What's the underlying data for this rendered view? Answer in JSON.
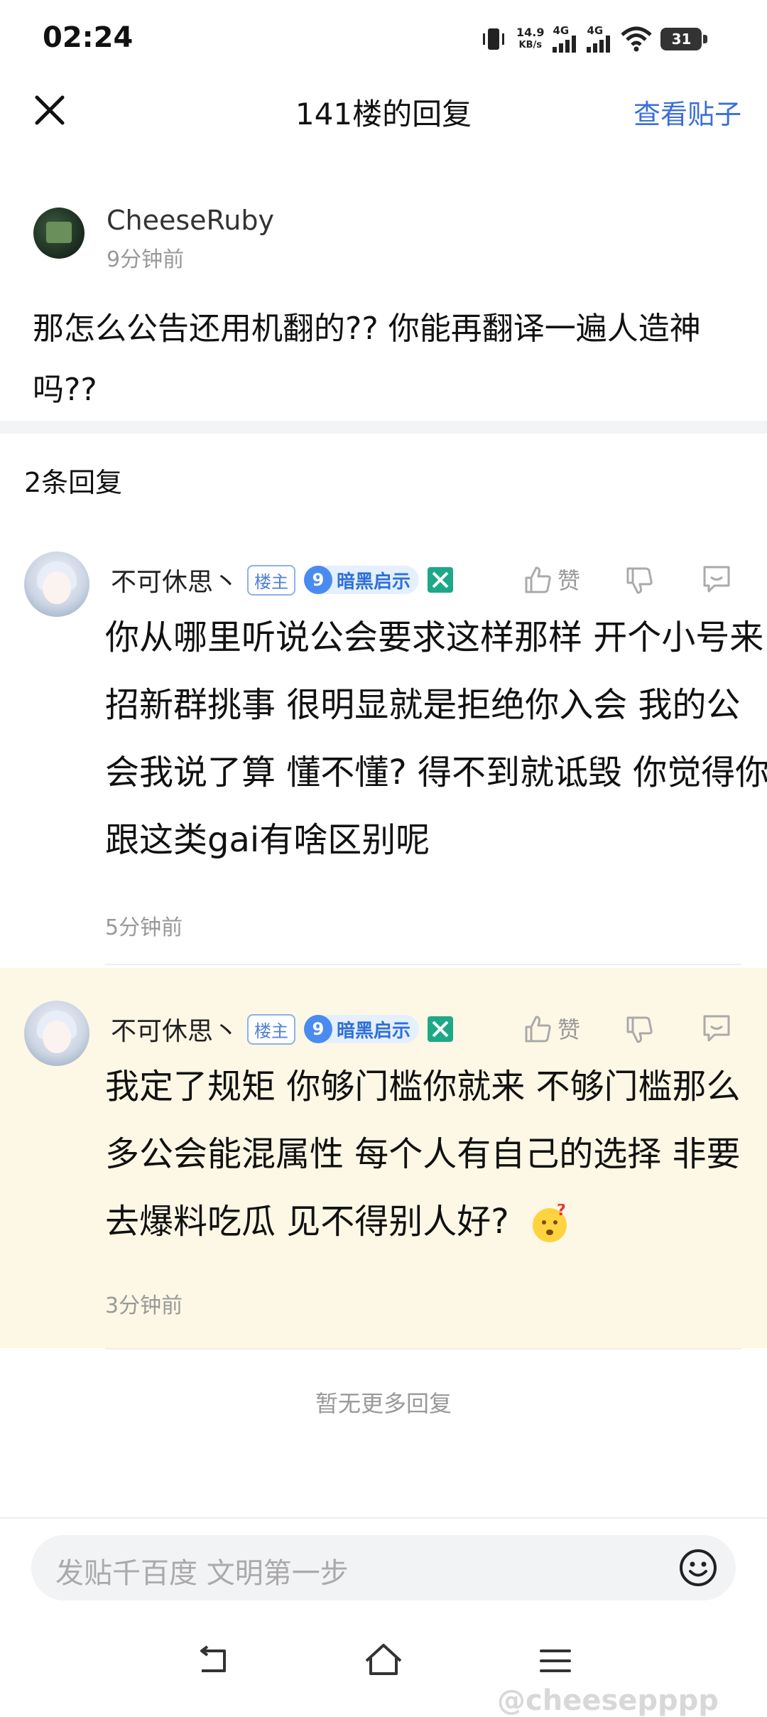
{
  "status_bar": {
    "time": "02:24",
    "speed_value": "14.9",
    "speed_unit": "KB/s",
    "net1": "4G",
    "net2": "4G",
    "battery": "31"
  },
  "header": {
    "title": "141楼的回复",
    "link": "查看贴子"
  },
  "post": {
    "username": "CheeseRuby",
    "time": "9分钟前",
    "content": "那怎么公告还用机翻的??  你能再翻译一遍人造神吗??"
  },
  "reply_count": "2条回复",
  "replies": [
    {
      "username": "不可休思丶",
      "host_badge": "楼主",
      "level": "9",
      "level_name": "暗黑启示",
      "like_label": "赞",
      "content": "你从哪里听说公会要求这样那样 开个小号来招新群挑事 很明显就是拒绝你入会 我的公会我说了算 懂不懂?  得不到就诋毁 你觉得你跟这类gai有啥区别呢",
      "time": "5分钟前"
    },
    {
      "username": "不可休思丶",
      "host_badge": "楼主",
      "level": "9",
      "level_name": "暗黑启示",
      "like_label": "赞",
      "content": "我定了规矩 你够门槛你就来 不够门槛那么多公会能混属性 每个人有自己的选择 非要去爆料吃瓜 见不得别人好?",
      "time": "3分钟前"
    }
  ],
  "no_more": "暂无更多回复",
  "input": {
    "placeholder": "发贴千百度 文明第一步"
  },
  "watermark": "@cheesepppp",
  "colors": {
    "accent_blue": "#3a6fd8",
    "highlight_bg": "#fdf8e6",
    "badge_green": "#1fa888"
  }
}
